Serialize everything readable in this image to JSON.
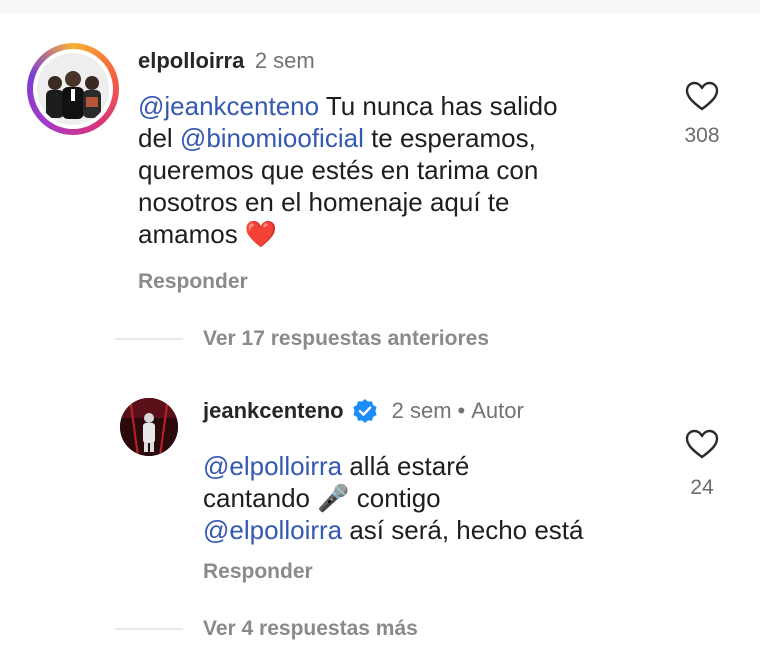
{
  "comment1": {
    "username": "elpolloirra",
    "time": "2 sem",
    "mention1": "@jeankcenteno",
    "text1": " Tu nunca has salido",
    "text2_pre": "del ",
    "mention2": "@binomiooficial",
    "text2_post": " te esperamos,",
    "text3": "queremos que estés en tarima con",
    "text4": "nosotros en el homenaje aquí te",
    "text5": "amamos ❤️",
    "reply_label": "Responder",
    "likes": "308"
  },
  "view_previous": "Ver 17 respuestas anteriores",
  "comment2": {
    "username": "jeankcenteno",
    "time": "2 sem",
    "separator": "•",
    "author_tag": "Autor",
    "mention1": "@elpolloirra",
    "text1": " allá estaré",
    "text2": "cantando 🎤 contigo",
    "mention2": "@elpolloirra",
    "text3": " así será, hecho está",
    "reply_label": "Responder",
    "likes": "24"
  },
  "view_more": "Ver 4 respuestas más",
  "colors": {
    "mention": "#3558b0",
    "verified": "#1d8cf8",
    "muted": "#8a8a8a"
  },
  "icons": [
    "heart-icon",
    "verified-badge-icon"
  ]
}
